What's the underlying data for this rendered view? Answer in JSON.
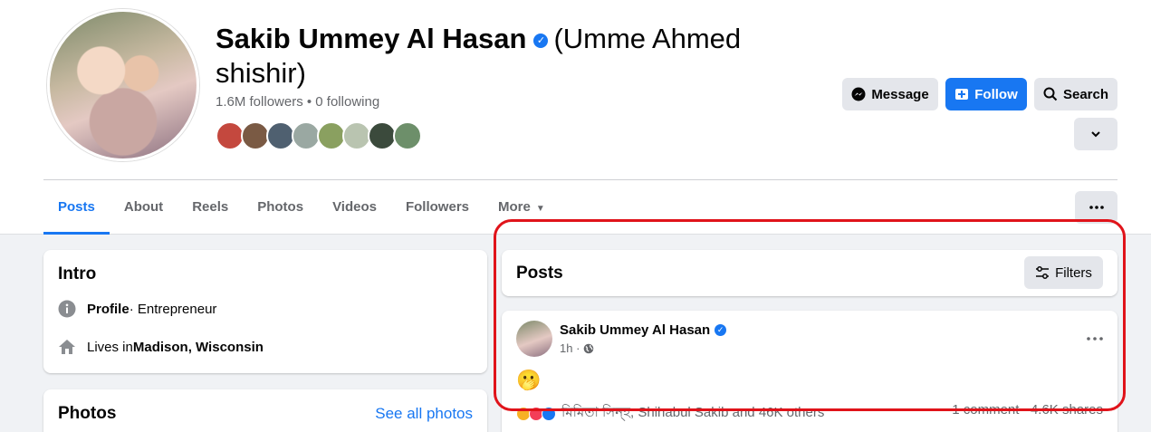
{
  "profile": {
    "name": "Sakib Ummey Al Hasan",
    "alt_name": "(Umme Ahmed shishir)",
    "followers_line": "1.6M followers • 0 following",
    "friend_avatar_colors": [
      "#c4483e",
      "#7a5a44",
      "#4f6070",
      "#9aa8a2",
      "#8aa060",
      "#b9c4b0",
      "#3b4a3c",
      "#6d8f6a"
    ]
  },
  "actions": {
    "message": "Message",
    "follow": "Follow",
    "search": "Search"
  },
  "tabs": [
    "Posts",
    "About",
    "Reels",
    "Photos",
    "Videos",
    "Followers",
    "More"
  ],
  "intro": {
    "title": "Intro",
    "profile_label": "Profile",
    "profile_type": " · Entrepreneur",
    "lives_prefix": "Lives in ",
    "lives_place": "Madison, Wisconsin"
  },
  "photos": {
    "title": "Photos",
    "see_all": "See all photos"
  },
  "posts_header": {
    "title": "Posts",
    "filters": "Filters"
  },
  "post": {
    "author": "Sakib Ummey Al Hasan",
    "time": "1h ·",
    "emoji": "🫢",
    "reactions_text": "মিমিতা সিন্হ, Shihabul Sakib and 46K others",
    "stats": "1 comment   4.6K shares"
  },
  "colors": {
    "accent": "#1877f2",
    "highlight_box": "#e0131a"
  }
}
